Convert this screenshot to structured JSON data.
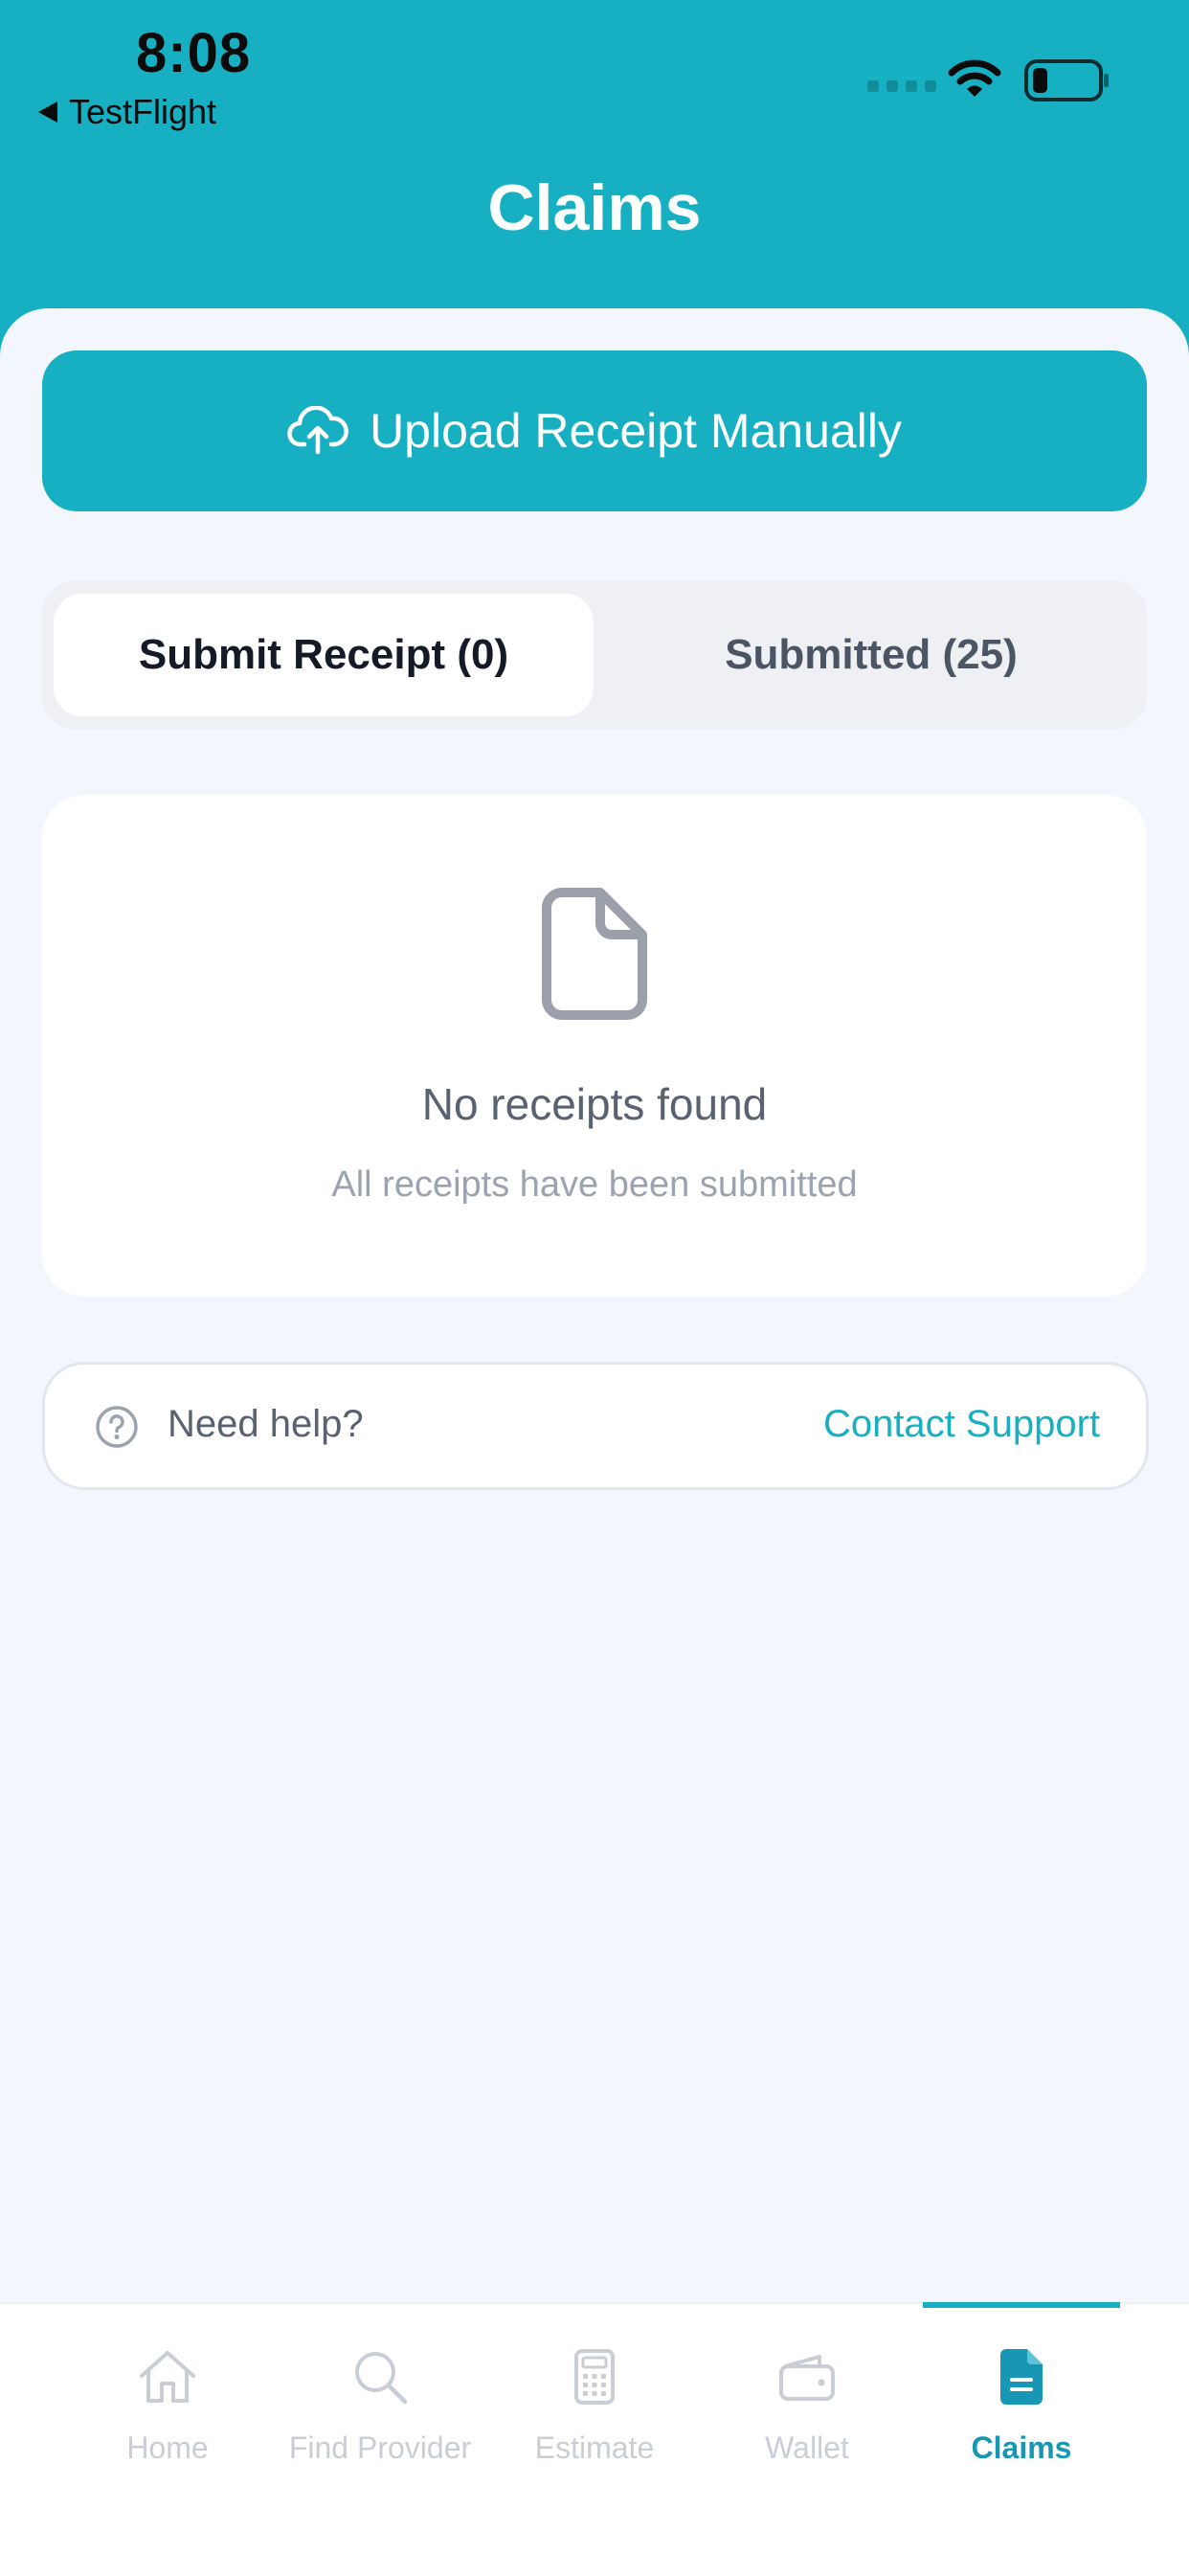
{
  "status_bar": {
    "time": "8:08",
    "back_label": "TestFlight"
  },
  "header": {
    "title": "Claims"
  },
  "upload": {
    "label": "Upload Receipt Manually"
  },
  "segments": {
    "active": "Submit Receipt (0)",
    "inactive": "Submitted (25)"
  },
  "empty_state": {
    "title": "No receipts found",
    "subtitle": "All receipts have been submitted"
  },
  "help": {
    "label": "Need help?",
    "link": "Contact Support"
  },
  "tabs": [
    {
      "label": "Home",
      "icon": "home-icon"
    },
    {
      "label": "Find Provider",
      "icon": "search-icon"
    },
    {
      "label": "Estimate",
      "icon": "calculator-icon"
    },
    {
      "label": "Wallet",
      "icon": "wallet-icon"
    },
    {
      "label": "Claims",
      "icon": "document-icon",
      "active": true
    }
  ],
  "colors": {
    "accent": "#17b0c3",
    "background": "#f3f6fc",
    "active_tab": "#1797b3"
  }
}
